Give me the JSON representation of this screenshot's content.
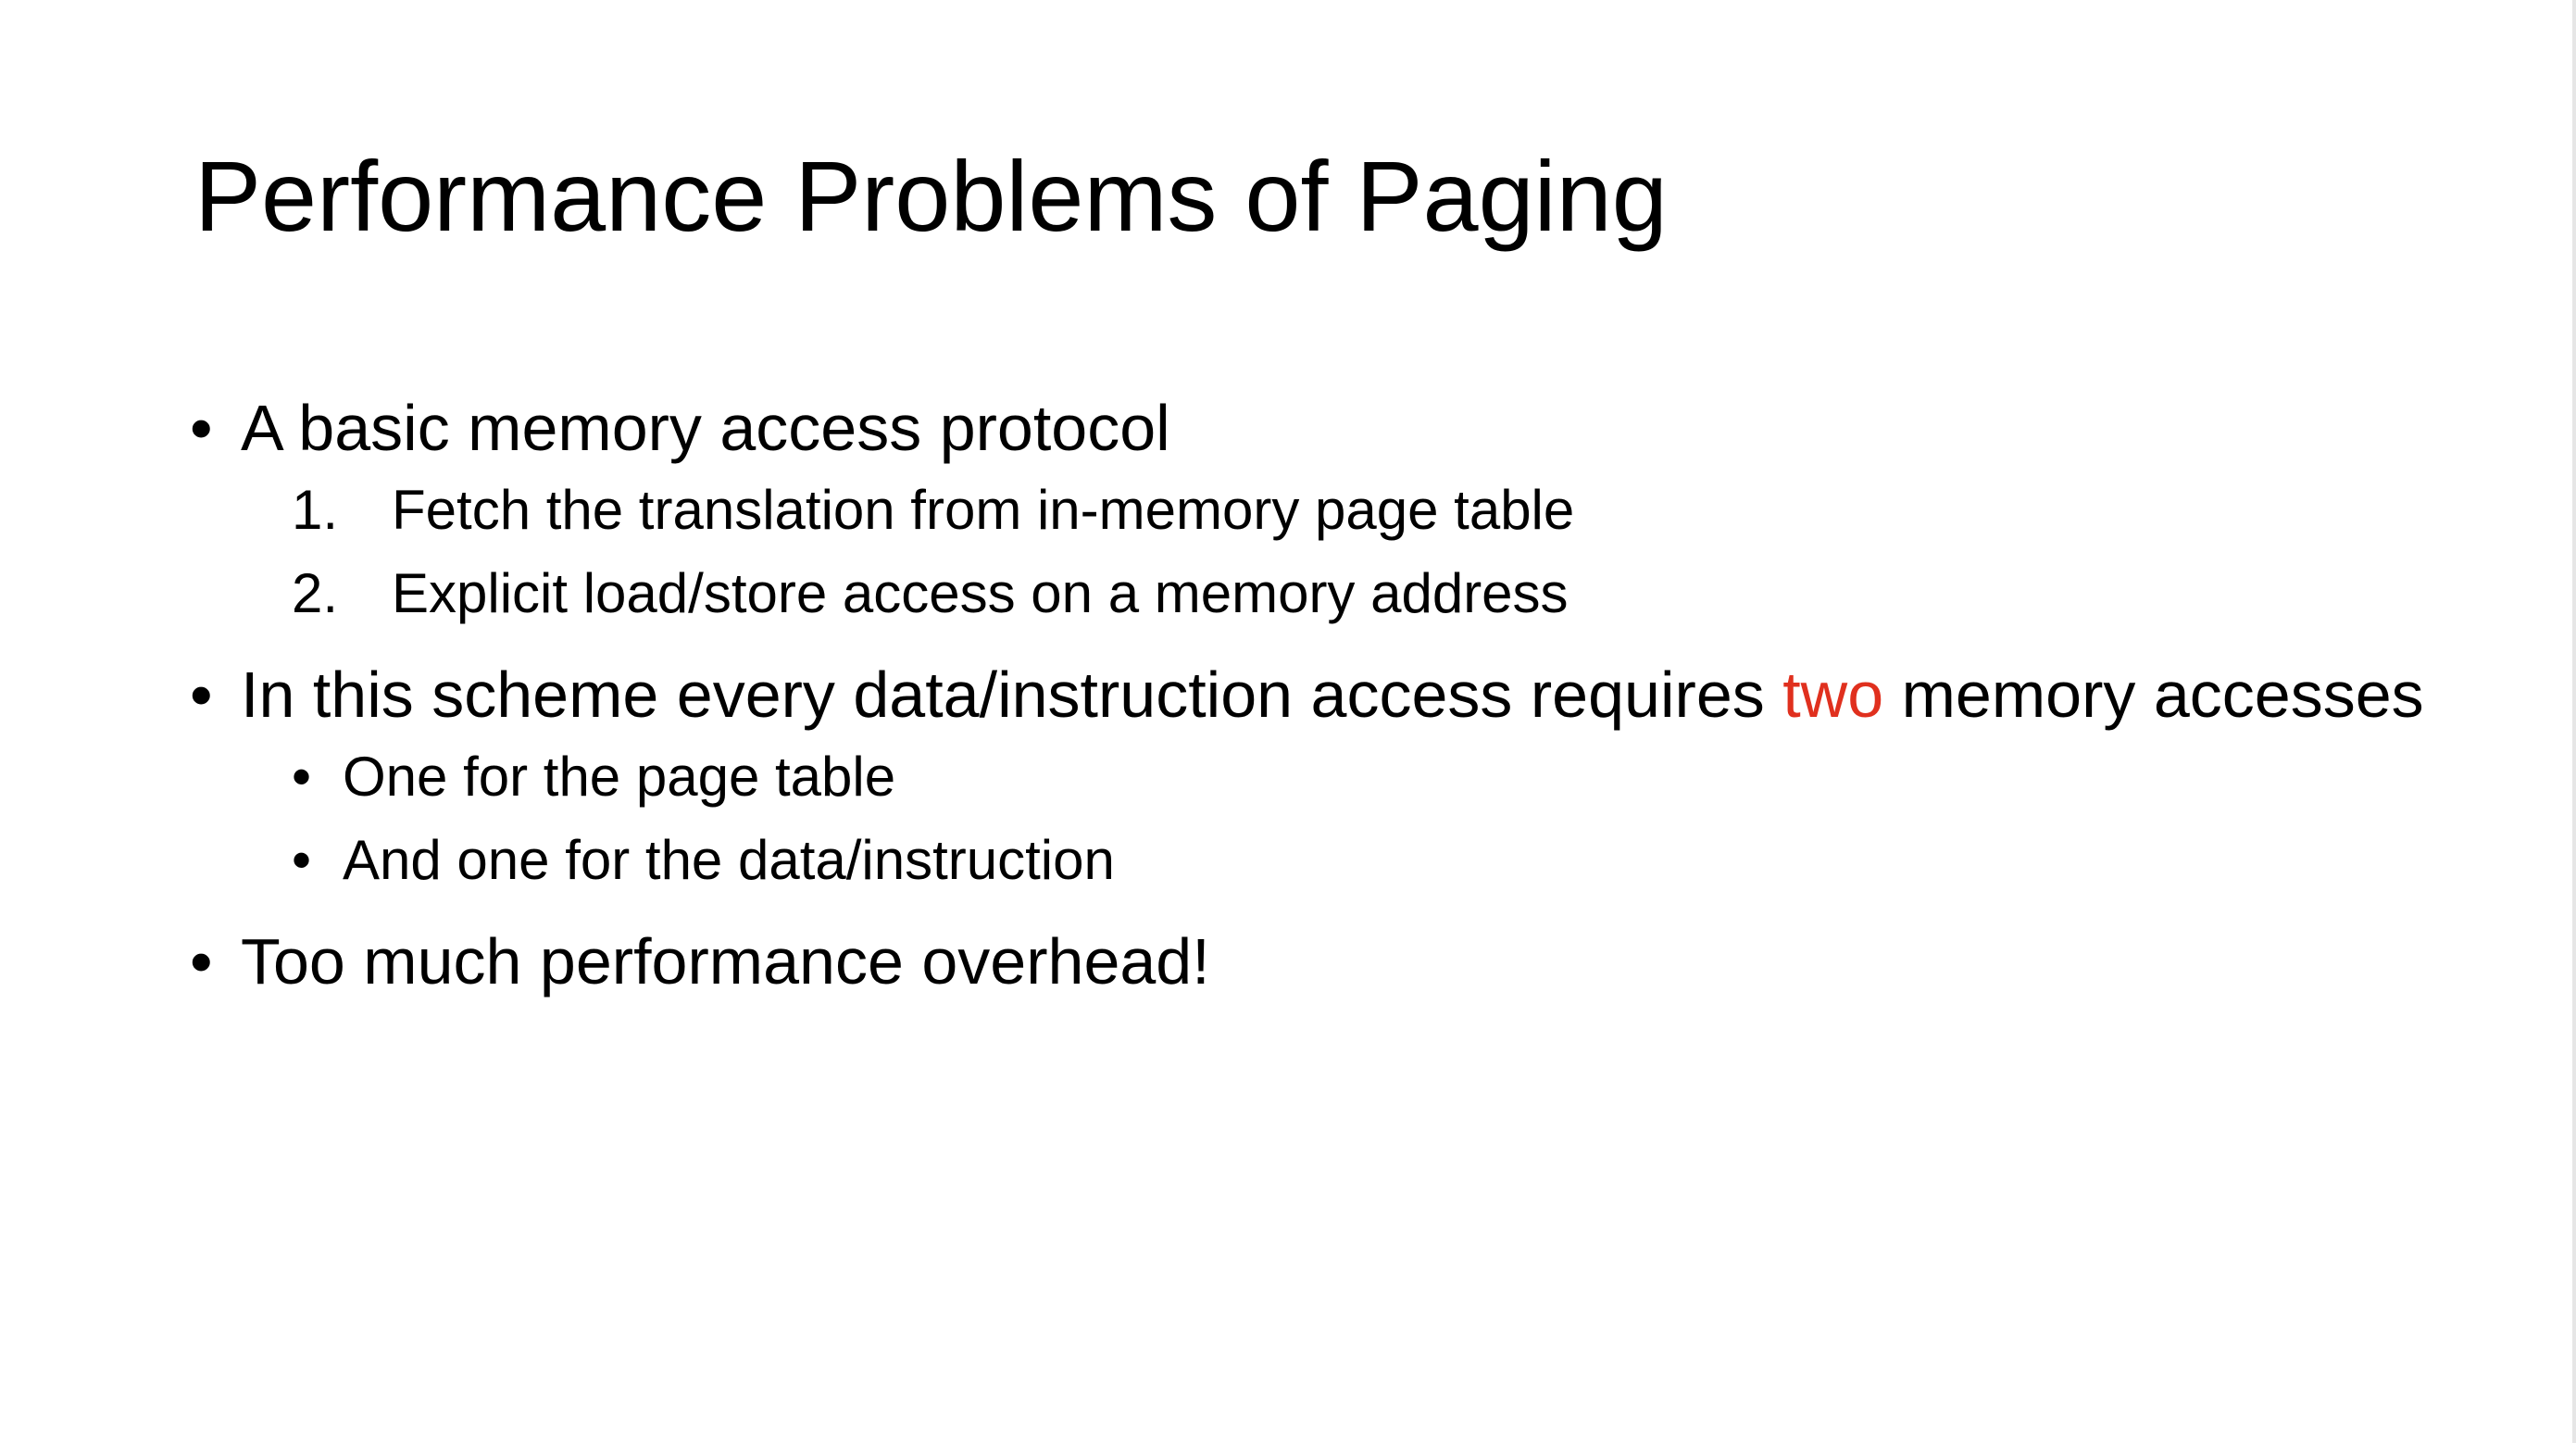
{
  "slide": {
    "title": "Performance Problems of Paging",
    "bullets": [
      {
        "marker": "•",
        "text": "A basic memory access protocol",
        "subitems": [
          {
            "marker": "1.",
            "text": "Fetch the translation from in-memory page table"
          },
          {
            "marker": "2.",
            "text": "Explicit load/store access on a memory address"
          }
        ]
      },
      {
        "marker": "•",
        "text_before": "In this scheme every data/instruction access requires ",
        "highlight": "two",
        "text_after": " memory accesses",
        "subitems": [
          {
            "marker": "•",
            "text": "One for the page table"
          },
          {
            "marker": "•",
            "text": "And one for the data/instruction"
          }
        ]
      },
      {
        "marker": "•",
        "text": "Too much performance overhead!"
      }
    ],
    "colors": {
      "highlight": "#e0301e",
      "text": "#000000",
      "background": "#ffffff"
    }
  }
}
